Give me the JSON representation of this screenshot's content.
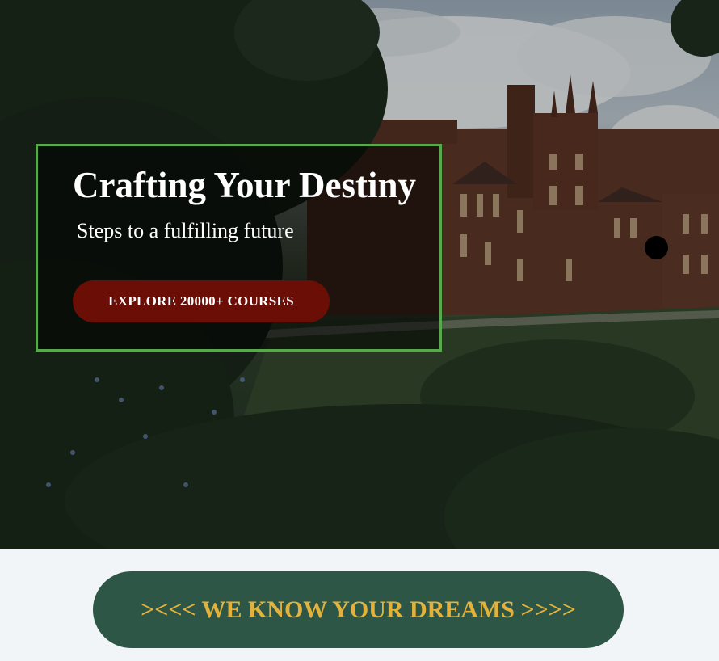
{
  "hero": {
    "title": "Crafting Your Destiny",
    "subtitle": "Steps to a fulfilling future",
    "cta_label": "EXPLORE 20000+ COURSES"
  },
  "banner": {
    "text": "><<< WE KNOW YOUR DREAMS >>>>"
  },
  "colors": {
    "overlay_border": "#5aa84e",
    "cta_background": "#6b0f06",
    "banner_background": "#2e5646",
    "banner_text": "#e3b23c",
    "page_background": "#f2f5f8"
  }
}
